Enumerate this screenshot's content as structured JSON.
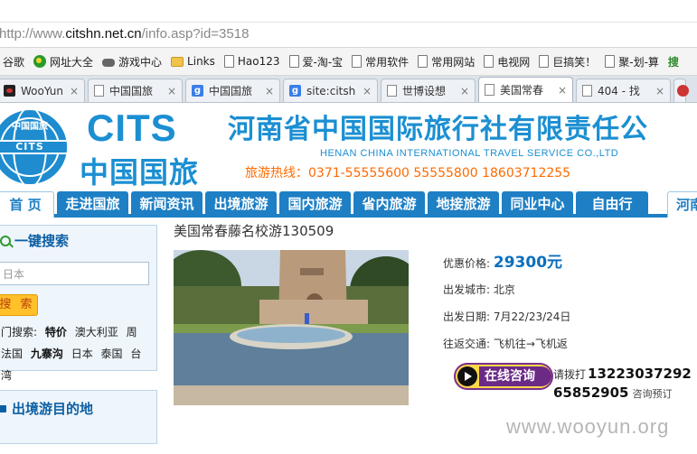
{
  "browser": {
    "url_scheme": "http://www.",
    "url_host": "citshn.net.cn",
    "url_path": "/info.asp?id=3518",
    "bookmarks": [
      {
        "label": "谷歌",
        "icon": "page-icon"
      },
      {
        "label": "网址大全",
        "icon": "nav-icon"
      },
      {
        "label": "游戏中心",
        "icon": "gamepad-icon"
      },
      {
        "label": "Links",
        "icon": "folder-icon"
      },
      {
        "label": "Hao123",
        "icon": "page-icon"
      },
      {
        "label": "爱-淘-宝",
        "icon": "page-icon"
      },
      {
        "label": "常用软件",
        "icon": "page-icon"
      },
      {
        "label": "常用网站",
        "icon": "page-icon"
      },
      {
        "label": "电视网",
        "icon": "page-icon"
      },
      {
        "label": "巨搞笑！",
        "icon": "page-icon"
      },
      {
        "label": "聚-划-算",
        "icon": "page-icon"
      },
      {
        "label": "搜",
        "icon": ""
      }
    ],
    "tabs": [
      {
        "title": "WooYun",
        "icon": "wooyun-icon",
        "active": false
      },
      {
        "title": "中国国旅",
        "icon": "page-icon",
        "active": false
      },
      {
        "title": "中国国旅",
        "icon": "google-icon",
        "active": false
      },
      {
        "title": "site:citsh",
        "icon": "google-icon",
        "active": false
      },
      {
        "title": "世博设想",
        "icon": "page-icon",
        "active": false
      },
      {
        "title": "美国常春",
        "icon": "page-icon",
        "active": true
      },
      {
        "title": "404 - 找",
        "icon": "page-icon",
        "active": false
      }
    ],
    "tab_close_glyph": "×",
    "google_glyph": "g"
  },
  "site": {
    "logo_en": "CITS",
    "logo_cn": "中国国旅",
    "globe_top": "中国国旅",
    "globe_band": "CITS",
    "company_cn": "河南省中国国际旅行社有限责任公",
    "company_en": "HENAN CHINA INTERNATIONAL TRAVEL SERVICE CO.,LTD",
    "hotline": "旅游热线：0371-55555600  55555800  18603712255",
    "nav": [
      "首 页",
      "走进国旅",
      "新闻资讯",
      "出境旅游",
      "国内旅游",
      "省内旅游",
      "地接旅游",
      "同业中心",
      "自由行",
      "河南"
    ]
  },
  "sidebar": {
    "search_title": "一键搜索",
    "search_placeholder": "日本",
    "search_button": "搜 索",
    "hot_label": "门搜索:",
    "hot_terms_line1": [
      "特价",
      "澳大利亚",
      "周"
    ],
    "hot_terms_line2": [
      "法国",
      "九寨沟",
      "日本",
      "泰国",
      "台湾"
    ],
    "dest_title": "出境游目的地"
  },
  "product": {
    "title": "美国常春藤名校游130509",
    "price_label": "优惠价格:",
    "price": "29300元",
    "city_label": "出发城市:",
    "city": "北京",
    "date_label": "出发日期:",
    "date": "7月22/23/24日",
    "transport_label": "往返交通:",
    "transport": "飞机往→飞机返",
    "consult_button": "在线咨询",
    "call_prefix": "请拨打",
    "call_number": "13223037292",
    "call_number2": "65852905",
    "call_suffix": "咨询预订"
  },
  "watermark": "www.wooyun.org"
}
